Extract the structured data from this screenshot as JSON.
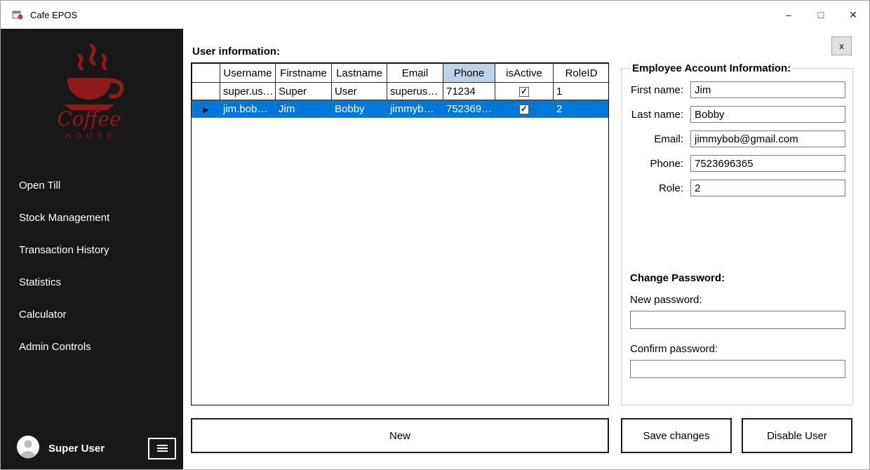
{
  "window": {
    "title": "Cafe EPOS",
    "minimize_glyph": "–",
    "maximize_glyph": "□",
    "close_glyph": "✕"
  },
  "sidebar": {
    "logo": {
      "line1": "Coffee",
      "line2": "HOUSE"
    },
    "items": [
      {
        "label": "Open Till"
      },
      {
        "label": "Stock Management"
      },
      {
        "label": "Transaction History"
      },
      {
        "label": "Statistics"
      },
      {
        "label": "Calculator"
      },
      {
        "label": "Admin Controls"
      }
    ],
    "user_name": "Super User"
  },
  "main": {
    "section_title": "User information:",
    "grid": {
      "selected_marker": "▶",
      "columns": [
        "Username",
        "Firstname",
        "Lastname",
        "Email",
        "Phone",
        "isActive",
        "RoleID"
      ],
      "highlighted_column": "Phone",
      "rows": [
        {
          "username": "super.us…",
          "firstname": "Super",
          "lastname": "User",
          "email": "superus…",
          "phone": "71234",
          "isActive": true,
          "roleId": "1"
        },
        {
          "username": "jim.bob…",
          "firstname": "Jim",
          "lastname": "Bobby",
          "email": "jimmyb…",
          "phone": "752369…",
          "isActive": true,
          "roleId": "2"
        }
      ]
    },
    "new_button_label": "New"
  },
  "panel": {
    "close_button_label": "x",
    "group_title": "Employee Account Information:",
    "fields": [
      {
        "label": "First name:",
        "value": "Jim"
      },
      {
        "label": "Last name:",
        "value": "Bobby"
      },
      {
        "label": "Email:",
        "value": "jimmybob@gmail.com"
      },
      {
        "label": "Phone:",
        "value": "7523696365"
      },
      {
        "label": "Role:",
        "value": "2"
      }
    ],
    "password": {
      "title": "Change Password:",
      "new_label": "New password:",
      "confirm_label": "Confirm password:",
      "new_value": "",
      "confirm_value": ""
    },
    "save_button_label": "Save changes",
    "disable_button_label": "Disable User"
  },
  "colors": {
    "sidebar_bg": "#181818",
    "selection_blue": "#0078d7",
    "column_highlight": "#bdd3ea",
    "logo_red": "#8e1a1a"
  }
}
